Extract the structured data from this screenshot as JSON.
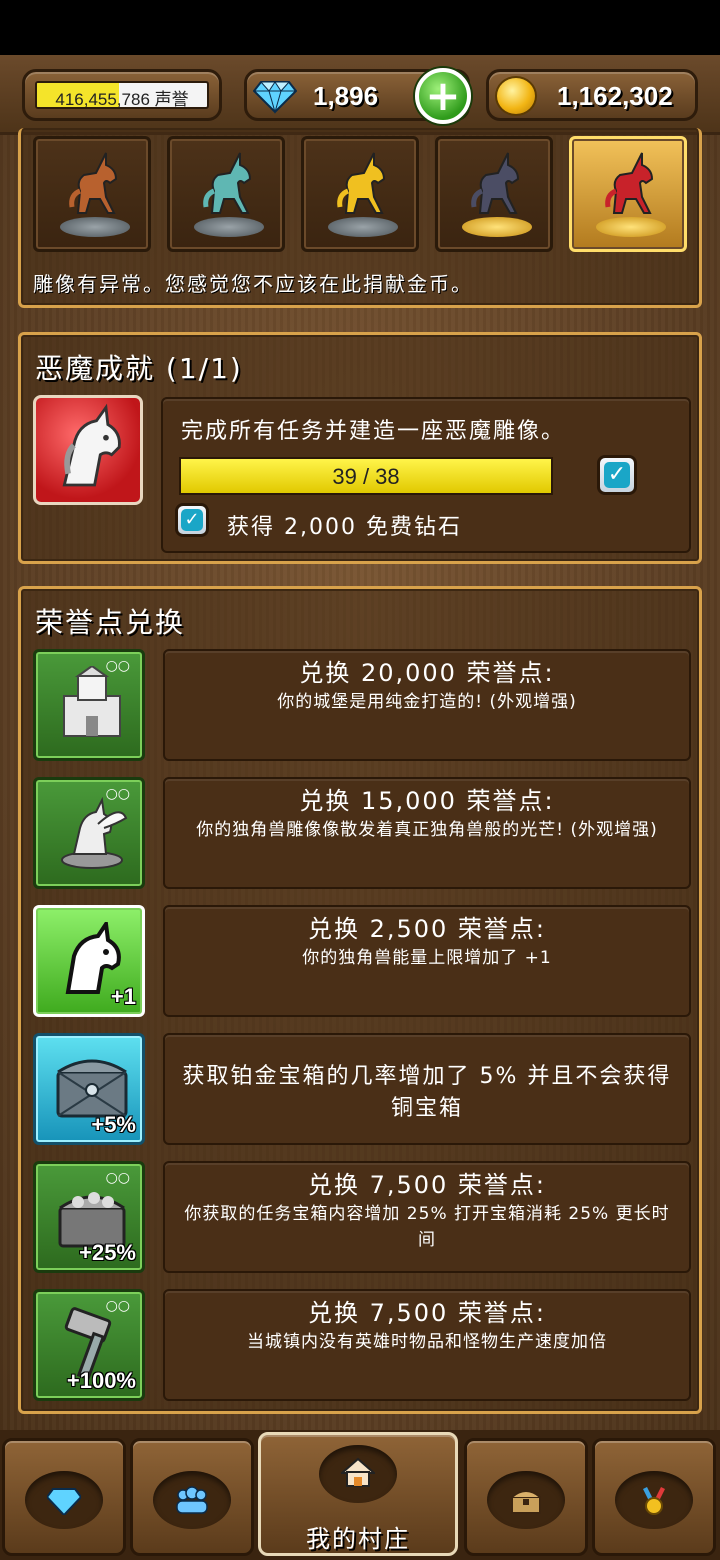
{
  "resources": {
    "honor_value": "416,455,786",
    "honor_unit": "声誉",
    "honor_fill": 0.48,
    "gems": "1,896",
    "coins": "1,162,302"
  },
  "statues": {
    "items": [
      {
        "name": "bronze-unicorn-statue",
        "color": "#b8612e",
        "base": "stone"
      },
      {
        "name": "silver-unicorn-statue",
        "color": "#5fb7b3",
        "base": "stone"
      },
      {
        "name": "gold-unicorn-statue",
        "color": "#f0c020",
        "base": "stone"
      },
      {
        "name": "dark-unicorn-statue",
        "color": "#4b4d64",
        "base": "gold"
      },
      {
        "name": "demon-unicorn-statue",
        "color": "#c8222a",
        "base": "gold"
      }
    ],
    "selected_index": 4,
    "message": "雕像有异常。您感觉您不应该在此捐献金币。"
  },
  "demon_achievement": {
    "title": "恶魔成就 (1/1)",
    "description": "完成所有任务并建造一座恶魔雕像。",
    "progress_text": "39 / 38",
    "progress_fraction": 1.0,
    "reward": "获得 2,000 免费钻石",
    "completed": true,
    "reward_claimed": true
  },
  "honor_exchange": {
    "title": "荣誉点兑换",
    "rows": [
      {
        "icon": "gold-castle-icon",
        "style": "green",
        "title": "兑换 20,000 荣誉点:",
        "desc": "你的城堡是用纯金打造的! (外观增强)",
        "badge": ""
      },
      {
        "icon": "pegasus-statue-icon",
        "style": "green",
        "title": "兑换 15,000 荣誉点:",
        "desc": "你的独角兽雕像像散发着真正独角兽般的光芒! (外观增强)",
        "badge": ""
      },
      {
        "icon": "unicorn-energy-icon",
        "style": "bright",
        "title": "兑换 2,500 荣誉点:",
        "desc": "你的独角兽能量上限增加了 +1",
        "badge": "+1"
      },
      {
        "icon": "platinum-chest-icon",
        "style": "cyan",
        "title": "",
        "desc": "获取铂金宝箱的几率增加了 5% 并且不会获得铜宝箱",
        "badge": "+5%"
      },
      {
        "icon": "quest-chest-icon",
        "style": "green",
        "title": "兑换 7,500 荣誉点:",
        "desc": "你获取的任务宝箱内容增加 25% 打开宝箱消耗 25% 更长时间",
        "badge": "+25%"
      },
      {
        "icon": "hammer-icon",
        "style": "green",
        "title": "兑换 7,500 荣誉点:",
        "desc": "当城镇内没有英雄时物品和怪物生产速度加倍",
        "badge": "+100%"
      }
    ]
  },
  "bottom_nav": {
    "items": [
      {
        "name": "nav-gems",
        "icon": "diamond-icon",
        "label": ""
      },
      {
        "name": "nav-heroes",
        "icon": "people-icon",
        "label": ""
      },
      {
        "name": "nav-my-village",
        "icon": "house-icon",
        "label": "我的村庄"
      },
      {
        "name": "nav-chest",
        "icon": "chest-icon",
        "label": ""
      },
      {
        "name": "nav-achievements",
        "icon": "medal-icon",
        "label": ""
      }
    ],
    "active_index": 2
  }
}
